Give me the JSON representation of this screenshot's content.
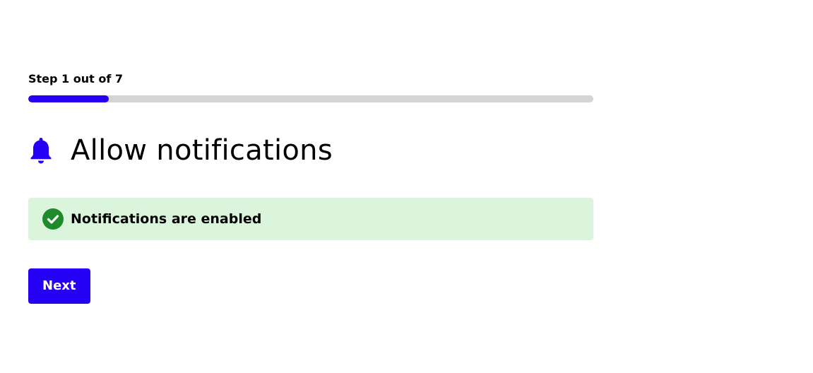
{
  "progress": {
    "label": "Step 1 out of 7",
    "current_step": 1,
    "total_steps": 7
  },
  "header": {
    "icon": "bell-icon",
    "title": "Allow notifications"
  },
  "alert": {
    "icon": "check-circle-icon",
    "message": "Notifications are enabled"
  },
  "actions": {
    "next_label": "Next"
  },
  "colors": {
    "accent": "#2500f5",
    "track": "#d4d4d4",
    "success_bg": "#daf5dc",
    "success_icon": "#1e8a2c",
    "text": "#000000"
  }
}
